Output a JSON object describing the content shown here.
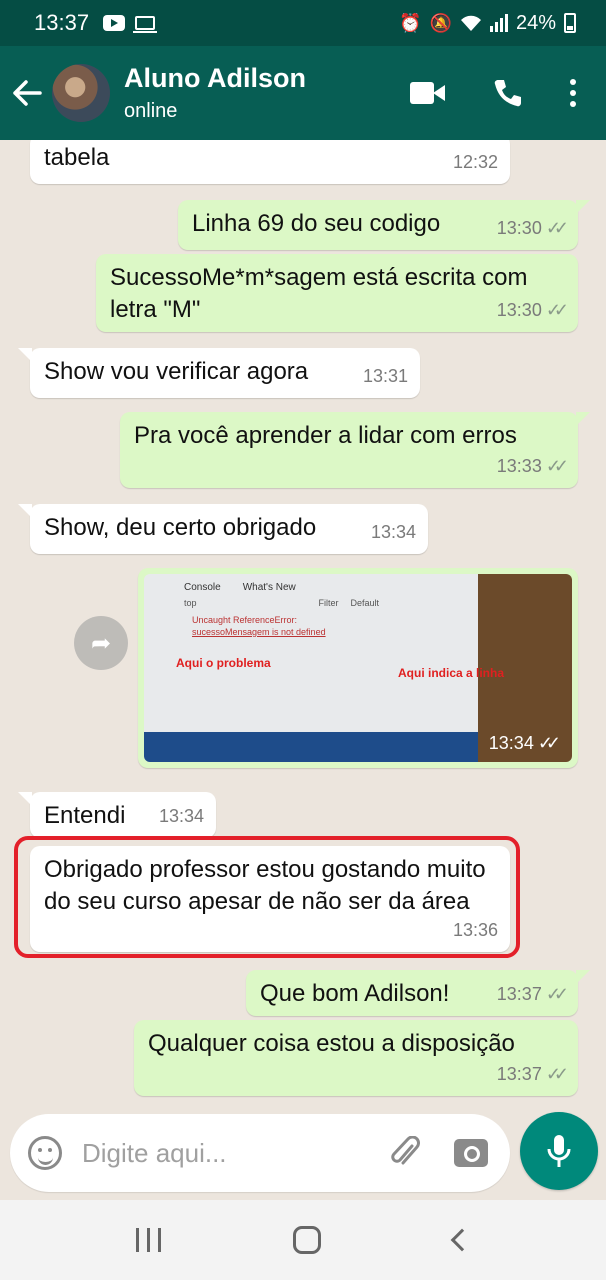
{
  "status_bar": {
    "time": "13:37",
    "battery": "24%",
    "icons": [
      "youtube-icon",
      "monitor-icon",
      "alarm-icon",
      "mute-icon",
      "wifi-icon",
      "signal-icon",
      "battery-icon"
    ]
  },
  "header": {
    "contact_name": "Aluno Adilson",
    "contact_status": "online",
    "icons": [
      "back-arrow-icon",
      "video-call-icon",
      "phone-icon",
      "more-options-icon"
    ]
  },
  "messages": [
    {
      "direction": "in",
      "text": "tabela",
      "time": "12:32"
    },
    {
      "direction": "out",
      "text": "Linha 69 do seu codigo",
      "time": "13:30",
      "ticks": "✓✓"
    },
    {
      "direction": "out",
      "text": "SucessoMe*m*sagem  está escrita com letra \"M\"",
      "time": "13:30",
      "ticks": "✓✓"
    },
    {
      "direction": "in",
      "text": "Show vou verificar agora",
      "time": "13:31"
    },
    {
      "direction": "out",
      "text": "Pra você aprender a lidar com erros",
      "time": "13:33",
      "ticks": "✓✓"
    },
    {
      "direction": "in",
      "text": "Show, deu certo obrigado",
      "time": "13:34"
    },
    {
      "direction": "out",
      "type": "image",
      "time": "13:34",
      "ticks": "✓✓",
      "image_text": {
        "tab_console": "Console",
        "tab_whats_new": "What's New",
        "top": "top",
        "filter": "Filter",
        "default": "Default",
        "error_line": "Uncaught ReferenceError:",
        "error_detail": "sucessoMensagem is not defined",
        "label_problem": "Aqui o problema",
        "label_line": "Aqui indica a linha"
      }
    },
    {
      "direction": "in",
      "text": "Entendi",
      "time": "13:34"
    },
    {
      "direction": "in",
      "text": "Obrigado professor estou gostando muito do seu curso apesar de não ser da área",
      "time": "13:36"
    },
    {
      "direction": "out",
      "text": "Que bom Adilson!",
      "time": "13:37",
      "ticks": "✓✓"
    },
    {
      "direction": "out",
      "text": "Qualquer coisa estou a disposição",
      "time": "13:37",
      "ticks": "✓✓"
    }
  ],
  "input": {
    "placeholder": "Digite aqui...",
    "icons": [
      "emoji-icon",
      "attach-icon",
      "camera-icon",
      "mic-icon"
    ]
  },
  "nav": {
    "icons": [
      "recent-apps-icon",
      "home-icon",
      "back-icon"
    ]
  },
  "colors": {
    "header": "#075e54",
    "status_bar": "#054d44",
    "outgoing_bubble": "#dcf8c6",
    "incoming_bubble": "#ffffff",
    "chat_bg": "#ece5dd",
    "mic_button": "#00897b",
    "highlight": "#e3202a"
  }
}
